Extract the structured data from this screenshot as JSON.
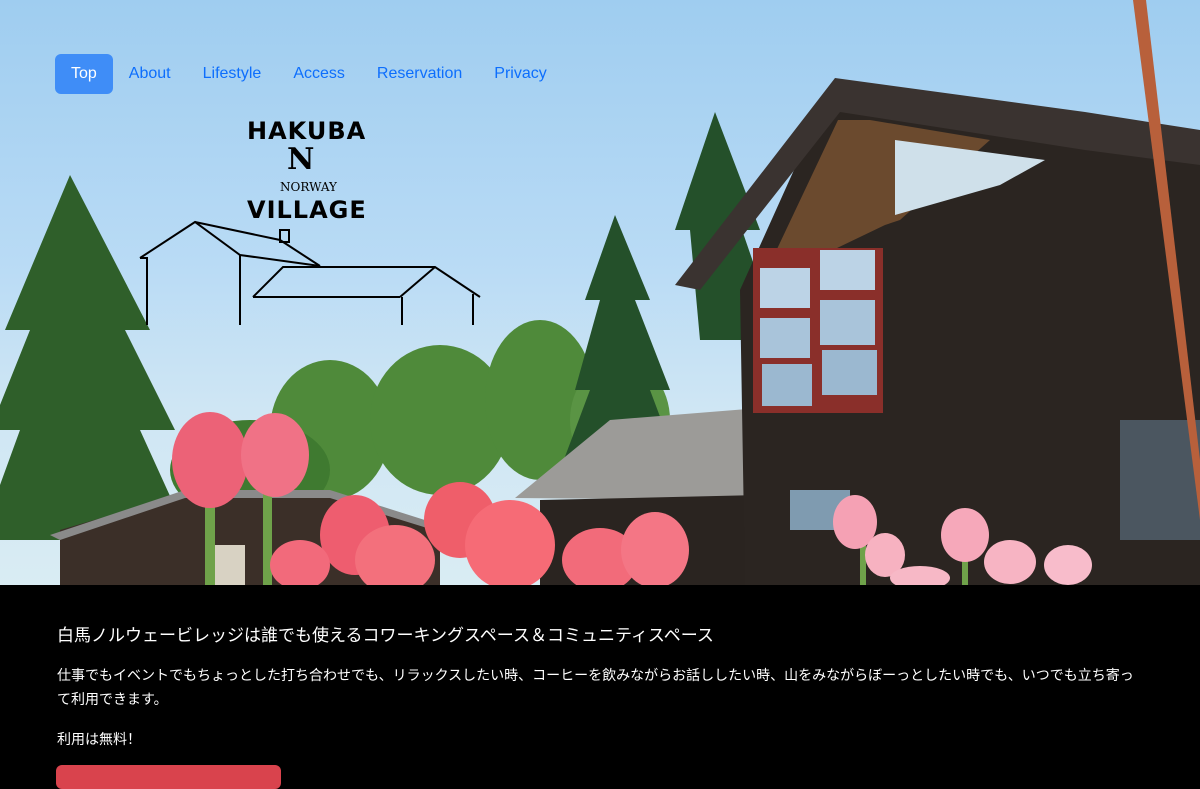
{
  "nav": {
    "items": [
      {
        "label": "Top",
        "active": true
      },
      {
        "label": "About",
        "active": false
      },
      {
        "label": "Lifestyle",
        "active": false
      },
      {
        "label": "Access",
        "active": false
      },
      {
        "label": "Reservation",
        "active": false
      },
      {
        "label": "Privacy",
        "active": false
      }
    ]
  },
  "logo": {
    "line1": "HAKUBA",
    "line2": "N",
    "line3": "NORWAY",
    "line4": "VILLAGE"
  },
  "content": {
    "headline": "白馬ノルウェービレッジは誰でも使えるコワーキングスペース＆コミュニティスペース",
    "description": "仕事でもイベントでもちょっとした打ち合わせでも、リラックスしたい時、コーヒーを飲みながらお話ししたい時、山をみながらぼーっとしたい時でも、いつでも立ち寄って利用できます。",
    "free_note": "利用は無料！"
  },
  "colors": {
    "nav_active_bg": "#3f8df7",
    "nav_link": "#0d6efd",
    "cta_button": "#d9434d",
    "content_bg": "#000000"
  }
}
